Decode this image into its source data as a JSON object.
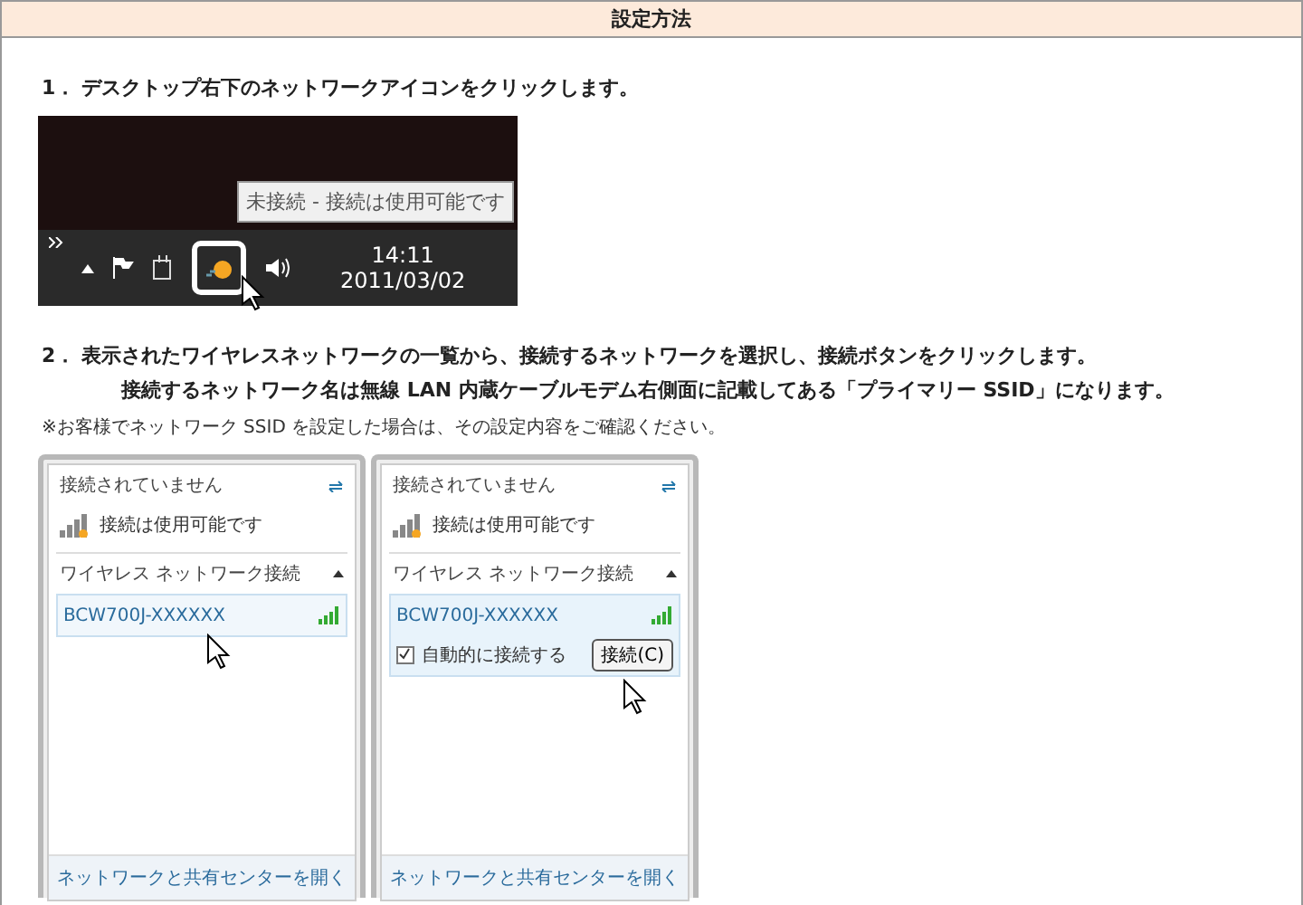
{
  "header": {
    "title": "設定方法"
  },
  "step_1": {
    "number": "1．",
    "lines": [
      "デスクトップ右下のネットワークアイコンをクリックします。"
    ]
  },
  "taskbar_screenshot": {
    "tooltip": "未接続 - 接続は使用可能です",
    "time": "14:11",
    "date": "2011/03/02"
  },
  "step_2": {
    "number": "2．",
    "lines": [
      "表示されたワイヤレスネットワークの一覧から、接続するネットワークを選択し、接続ボタンをクリックします。",
      "接続するネットワーク名は無線 LAN 内蔵ケーブルモデム右側面に記載してある「プライマリー SSID」になります。"
    ]
  },
  "note": "※お客様でネットワーク SSID を設定した場合は、その設定内容をご確認ください。",
  "panels": [
    {
      "status": "接続されていません",
      "availability": "接続は使用可能です",
      "section": "ワイヤレス ネットワーク接続",
      "network": "BCW700J-XXXXXX",
      "expanded": false,
      "footer_link": "ネットワークと共有センターを開く"
    },
    {
      "status": "接続されていません",
      "availability": "接続は使用可能です",
      "section": "ワイヤレス ネットワーク接続",
      "network": "BCW700J-XXXXXX",
      "expanded": true,
      "auto_connect_label": "自動的に接続する",
      "auto_connect_checked": true,
      "connect_button": "接続(C)",
      "footer_link": "ネットワークと共有センターを開く"
    }
  ]
}
